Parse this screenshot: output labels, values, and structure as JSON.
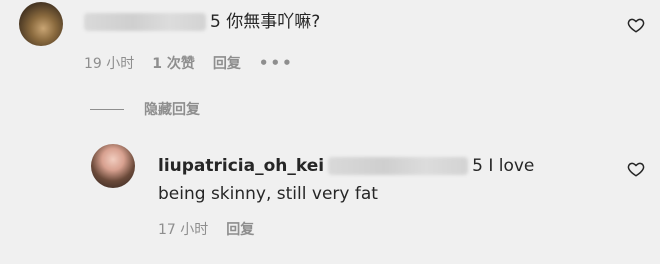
{
  "comment": {
    "text_tail": "5 你無事吖嘛?",
    "time": "19 小时",
    "likes": "1 次赞",
    "reply_label": "回复",
    "more": "•••"
  },
  "hidden_replies": {
    "label": "隐藏回复"
  },
  "reply": {
    "username": "liupatricia_oh_kei",
    "text_tail": "5 I love being skinny, still very fat",
    "time": "17 小时",
    "reply_label": "回复"
  },
  "colors": {
    "background": "#f0f0f0",
    "text": "#262626",
    "secondary": "#8e8e8e"
  },
  "icons": {
    "like": "heart-outline-icon",
    "more": "more-horizontal-icon"
  }
}
